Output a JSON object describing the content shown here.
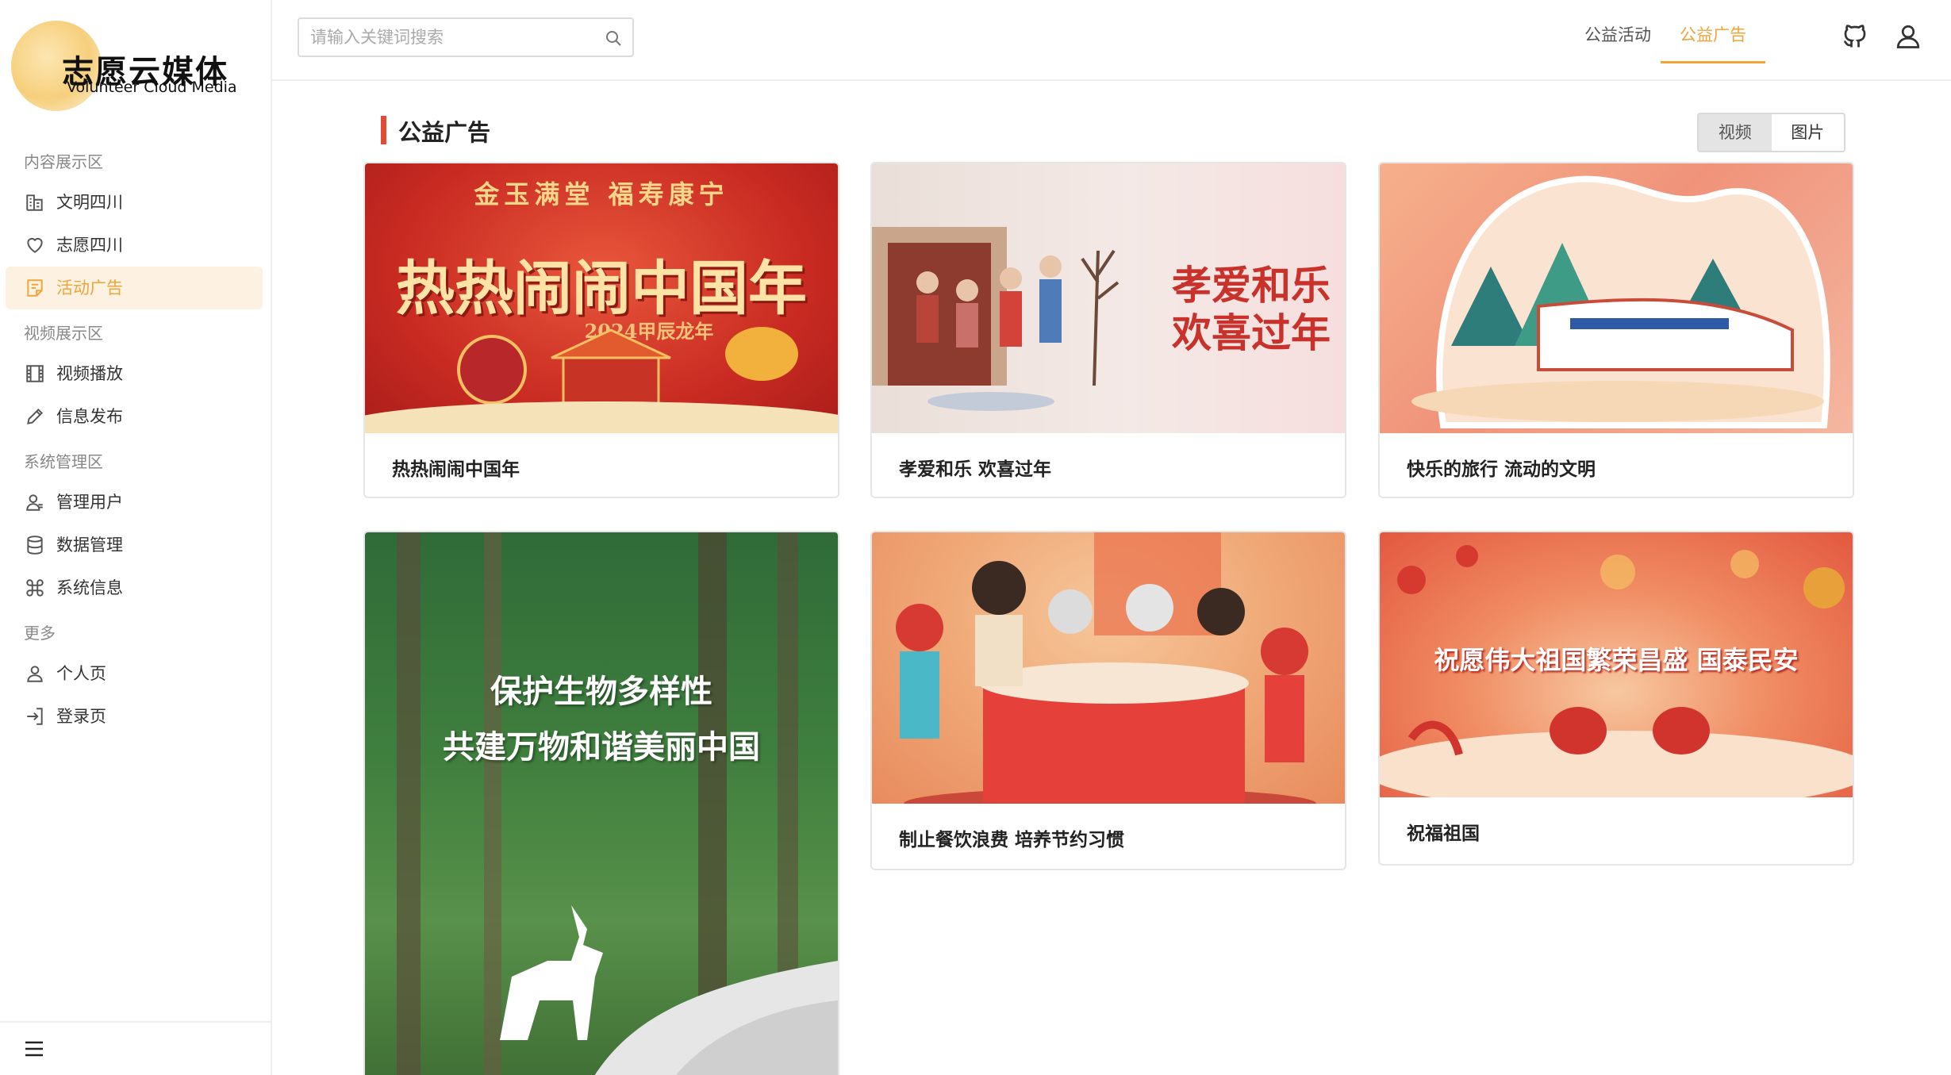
{
  "app": {
    "logo_title": "志愿云媒体",
    "logo_subtitle": "Volunteer Cloud Media"
  },
  "sidebar": {
    "sections": [
      {
        "label": "内容展示区"
      },
      {
        "label": "视频展示区"
      },
      {
        "label": "系统管理区"
      },
      {
        "label": "更多"
      }
    ],
    "items": [
      {
        "label": "文明四川",
        "icon": "building-icon"
      },
      {
        "label": "志愿四川",
        "icon": "heart-icon"
      },
      {
        "label": "活动广告",
        "icon": "notes-icon",
        "active": true
      },
      {
        "label": "视频播放",
        "icon": "film-icon"
      },
      {
        "label": "信息发布",
        "icon": "pencil-icon"
      },
      {
        "label": "管理用户",
        "icon": "user-manage-icon"
      },
      {
        "label": "数据管理",
        "icon": "database-icon"
      },
      {
        "label": "系统信息",
        "icon": "command-icon"
      },
      {
        "label": "个人页",
        "icon": "user-icon"
      },
      {
        "label": "登录页",
        "icon": "login-icon"
      }
    ]
  },
  "header": {
    "search_placeholder": "请输入关键词搜索",
    "tabs": [
      {
        "label": "公益活动"
      },
      {
        "label": "公益广告",
        "active": true
      }
    ]
  },
  "main": {
    "section_title": "公益广告",
    "view_toggle": [
      {
        "label": "视频",
        "selected": true
      },
      {
        "label": "图片"
      }
    ],
    "cards": [
      {
        "title": "热热闹闹中国年",
        "poster_lines": [
          "金玉满堂  福寿康宁",
          "热热闹闹中国年",
          "2024甲辰龙年"
        ]
      },
      {
        "title": "孝爱和乐 欢喜过年",
        "poster_lines": [
          "孝爱和乐",
          "欢喜过年"
        ]
      },
      {
        "title": "快乐的旅行 流动的文明",
        "poster_lines": []
      },
      {
        "title": "",
        "poster_lines": [
          "保护生物多样性",
          "共建万物和谐美丽中国"
        ]
      },
      {
        "title": "制止餐饮浪费 培养节约习惯",
        "poster_lines": []
      },
      {
        "title": "祝福祖国",
        "poster_lines": [
          "祝愿伟大祖国繁荣昌盛 国泰民安"
        ]
      }
    ]
  },
  "colors": {
    "accent": "#f0a43a",
    "section_bar": "#e34a33",
    "active_bg": "#fdf2e2"
  }
}
